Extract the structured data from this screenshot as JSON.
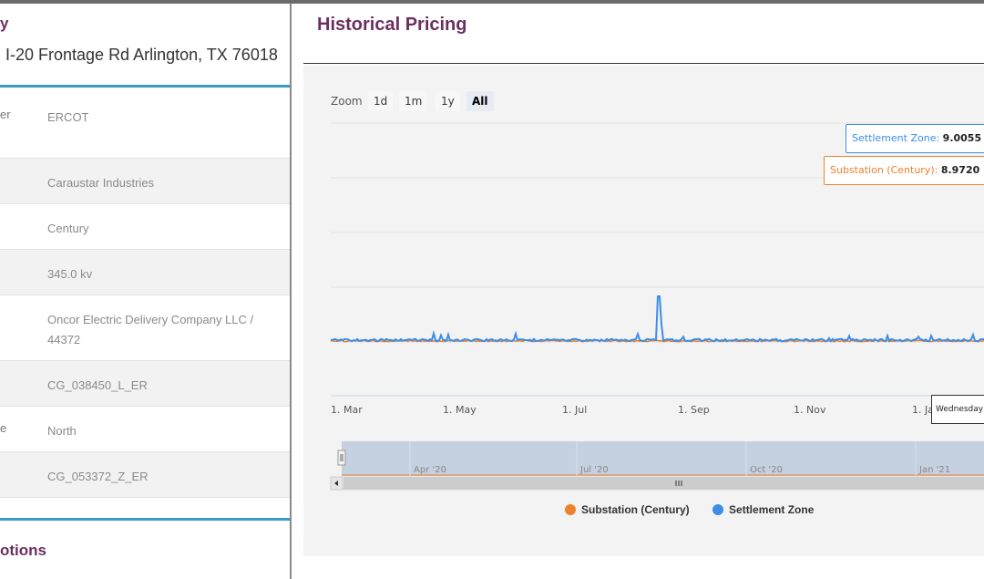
{
  "left_panel": {
    "title_fragment": "y",
    "address": "I-20 Frontage Rd Arlington, TX 76018",
    "rows": [
      {
        "key_fragment": "er",
        "value": "ERCOT"
      },
      {
        "key_fragment": "",
        "value": "Caraustar Industries"
      },
      {
        "key_fragment": "",
        "value": "Century"
      },
      {
        "key_fragment": "",
        "value": "345.0 kv"
      },
      {
        "key_fragment": "",
        "value": "Oncor Electric Delivery Company LLC / 44372"
      },
      {
        "key_fragment": "",
        "value": "CG_038450_L_ER"
      },
      {
        "key_fragment": "e",
        "value": "North"
      },
      {
        "key_fragment": "",
        "value": "CG_053372_Z_ER"
      }
    ],
    "options_fragment": "otions"
  },
  "historical": {
    "title": "Historical Pricing",
    "zoom": {
      "label": "Zoom",
      "buttons": [
        "1d",
        "1m",
        "1y",
        "All"
      ],
      "active": "All"
    },
    "tooltip_settlement": {
      "label": "Settlement Zone",
      "value": "9.0055"
    },
    "tooltip_substation": {
      "label": "Substation (Century)",
      "value": "8.9720"
    },
    "date_tooltip": "Wednesday",
    "navigator_labels": [
      "Apr '20",
      "Jul '20",
      "Oct '20",
      "Jan '21"
    ]
  },
  "chart_data": {
    "type": "line",
    "x_tick_labels": [
      "1. Mar",
      "1. May",
      "1. Jul",
      "1. Sep",
      "1. Nov",
      "1. Ja"
    ],
    "series": [
      {
        "name": "Substation (Century)",
        "color": "#f07f2a"
      },
      {
        "name": "Settlement Zone",
        "color": "#3c8ee8"
      }
    ],
    "grid": true,
    "legend_position": "bottom"
  }
}
